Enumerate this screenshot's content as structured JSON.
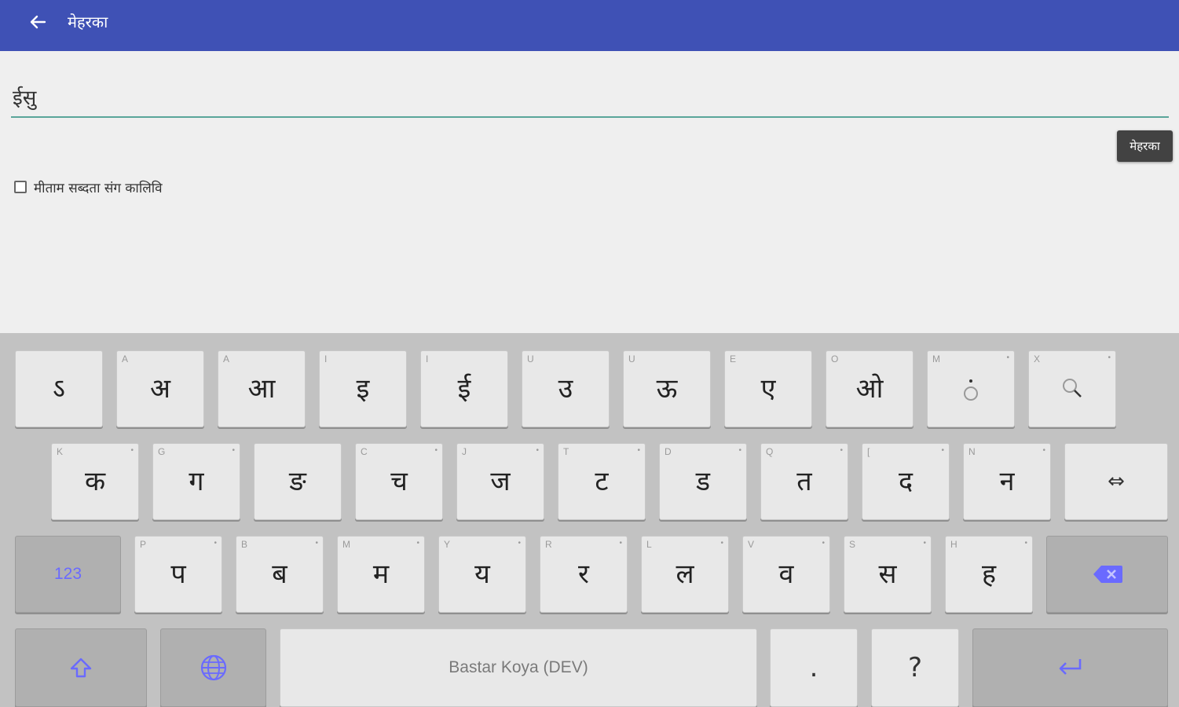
{
  "appbar": {
    "title": "मेहरका",
    "back_icon": "arrow-left-icon",
    "color": "#3f51b5"
  },
  "search": {
    "value": "ईसु",
    "button_label": "मेहरका",
    "accent": "#5aa59a"
  },
  "option": {
    "label": "मीताम सब्दता संग कालिवि",
    "checked": false
  },
  "keyboard": {
    "row1": [
      {
        "main": "ऽ",
        "hint": "",
        "dot": ""
      },
      {
        "main": "अ",
        "hint": "A",
        "dot": ""
      },
      {
        "main": "आ",
        "hint": "A",
        "dot": ""
      },
      {
        "main": "इ",
        "hint": "I",
        "dot": ""
      },
      {
        "main": "ई",
        "hint": "I",
        "dot": ""
      },
      {
        "main": "उ",
        "hint": "U",
        "dot": ""
      },
      {
        "main": "ऊ",
        "hint": "U",
        "dot": ""
      },
      {
        "main": "ए",
        "hint": "E",
        "dot": ""
      },
      {
        "main": "ओ",
        "hint": "O",
        "dot": ""
      },
      {
        "main": "ं",
        "hint": "M",
        "dot": "•"
      },
      {
        "main": "़",
        "hint": "X",
        "dot": "•"
      }
    ],
    "row2": [
      {
        "main": "क",
        "hint": "K",
        "dot": "•"
      },
      {
        "main": "ग",
        "hint": "G",
        "dot": "•"
      },
      {
        "main": "ङ",
        "hint": "",
        "dot": ""
      },
      {
        "main": "च",
        "hint": "C",
        "dot": "•"
      },
      {
        "main": "ज",
        "hint": "J",
        "dot": "•"
      },
      {
        "main": "ट",
        "hint": "T",
        "dot": "•"
      },
      {
        "main": "ड",
        "hint": "D",
        "dot": "•"
      },
      {
        "main": "त",
        "hint": "Q",
        "dot": "•"
      },
      {
        "main": "द",
        "hint": "[",
        "dot": "•"
      },
      {
        "main": "न",
        "hint": "N",
        "dot": "•"
      }
    ],
    "zwj_key": "⇔",
    "row3": [
      {
        "main": "प",
        "hint": "P",
        "dot": "•"
      },
      {
        "main": "ब",
        "hint": "B",
        "dot": "•"
      },
      {
        "main": "म",
        "hint": "M",
        "dot": "•"
      },
      {
        "main": "य",
        "hint": "Y",
        "dot": "•"
      },
      {
        "main": "र",
        "hint": "R",
        "dot": "•"
      },
      {
        "main": "ल",
        "hint": "L",
        "dot": "•"
      },
      {
        "main": "व",
        "hint": "V",
        "dot": "•"
      },
      {
        "main": "स",
        "hint": "S",
        "dot": "•"
      },
      {
        "main": "ह",
        "hint": "H",
        "dot": "•"
      }
    ],
    "numbers_label": "123",
    "backspace_icon": "backspace-icon",
    "shift_icon": "shift-arrow-icon",
    "globe_icon": "globe-icon",
    "space_label": "Bastar Koya (DEV)",
    "period_label": ".",
    "question_label": "?",
    "enter_icon": "enter-return-icon",
    "accent": "#6a6aff"
  }
}
